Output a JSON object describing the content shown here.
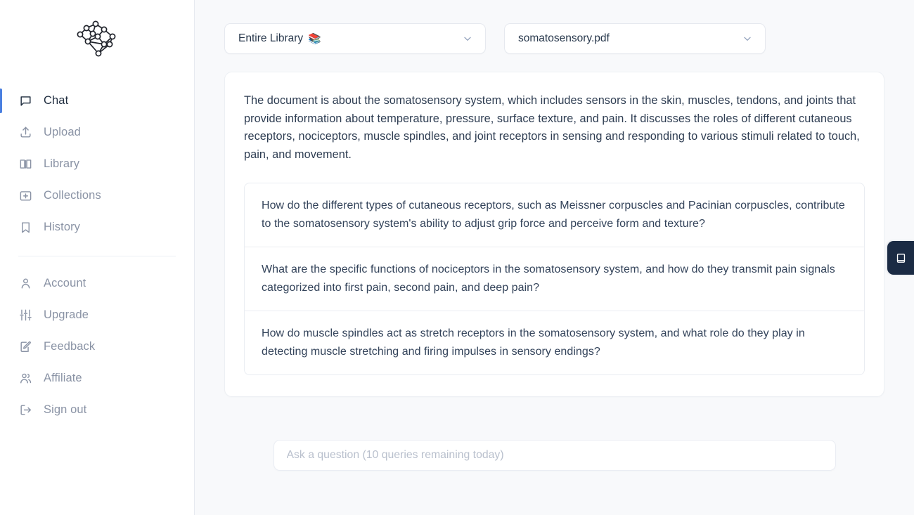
{
  "app": {
    "logo_name": "brain-network-logo",
    "accent_active": "#4a7fe0",
    "side_tab_bg": "#1b2b44"
  },
  "sidebar": {
    "primary_items": [
      {
        "label": "Chat",
        "icon": "chat-bubble-icon",
        "active": true
      },
      {
        "label": "Upload",
        "icon": "upload-icon",
        "active": false
      },
      {
        "label": "Library",
        "icon": "book-open-icon",
        "active": false
      },
      {
        "label": "Collections",
        "icon": "folder-plus-icon",
        "active": false
      },
      {
        "label": "History",
        "icon": "bookmark-icon",
        "active": false
      }
    ],
    "secondary_items": [
      {
        "label": "Account",
        "icon": "user-icon"
      },
      {
        "label": "Upgrade",
        "icon": "sliders-icon"
      },
      {
        "label": "Feedback",
        "icon": "edit-square-icon"
      },
      {
        "label": "Affiliate",
        "icon": "users-icon"
      },
      {
        "label": "Sign out",
        "icon": "logout-icon"
      }
    ]
  },
  "toolbar": {
    "scope_select": {
      "value": "Entire Library",
      "emoji": "📚",
      "icon": "chevron-down-icon"
    },
    "document_select": {
      "value": "somatosensory.pdf",
      "icon": "chevron-down-icon"
    }
  },
  "main": {
    "summary": "The document is about the somatosensory system, which includes sensors in the skin, muscles, tendons, and joints that provide information about temperature, pressure, surface texture, and pain. It discusses the roles of different cutaneous receptors, nociceptors, muscle spindles, and joint receptors in sensing and responding to various stimuli related to touch, pain, and movement.",
    "suggested_questions": [
      "How do the different types of cutaneous receptors, such as Meissner corpuscles and Pacinian corpuscles, contribute to the somatosensory system's ability to adjust grip force and perceive form and texture?",
      "What are the specific functions of nociceptors in the somatosensory system, and how do they transmit pain signals categorized into first pain, second pain, and deep pain?",
      "How do muscle spindles act as stretch receptors in the somatosensory system, and what role do they play in detecting muscle stretching and firing impulses in sensory endings?"
    ]
  },
  "composer": {
    "placeholder": "Ask a question (10 queries remaining today)",
    "value": ""
  },
  "side_panel_toggle": {
    "icon": "book-panel-icon"
  }
}
